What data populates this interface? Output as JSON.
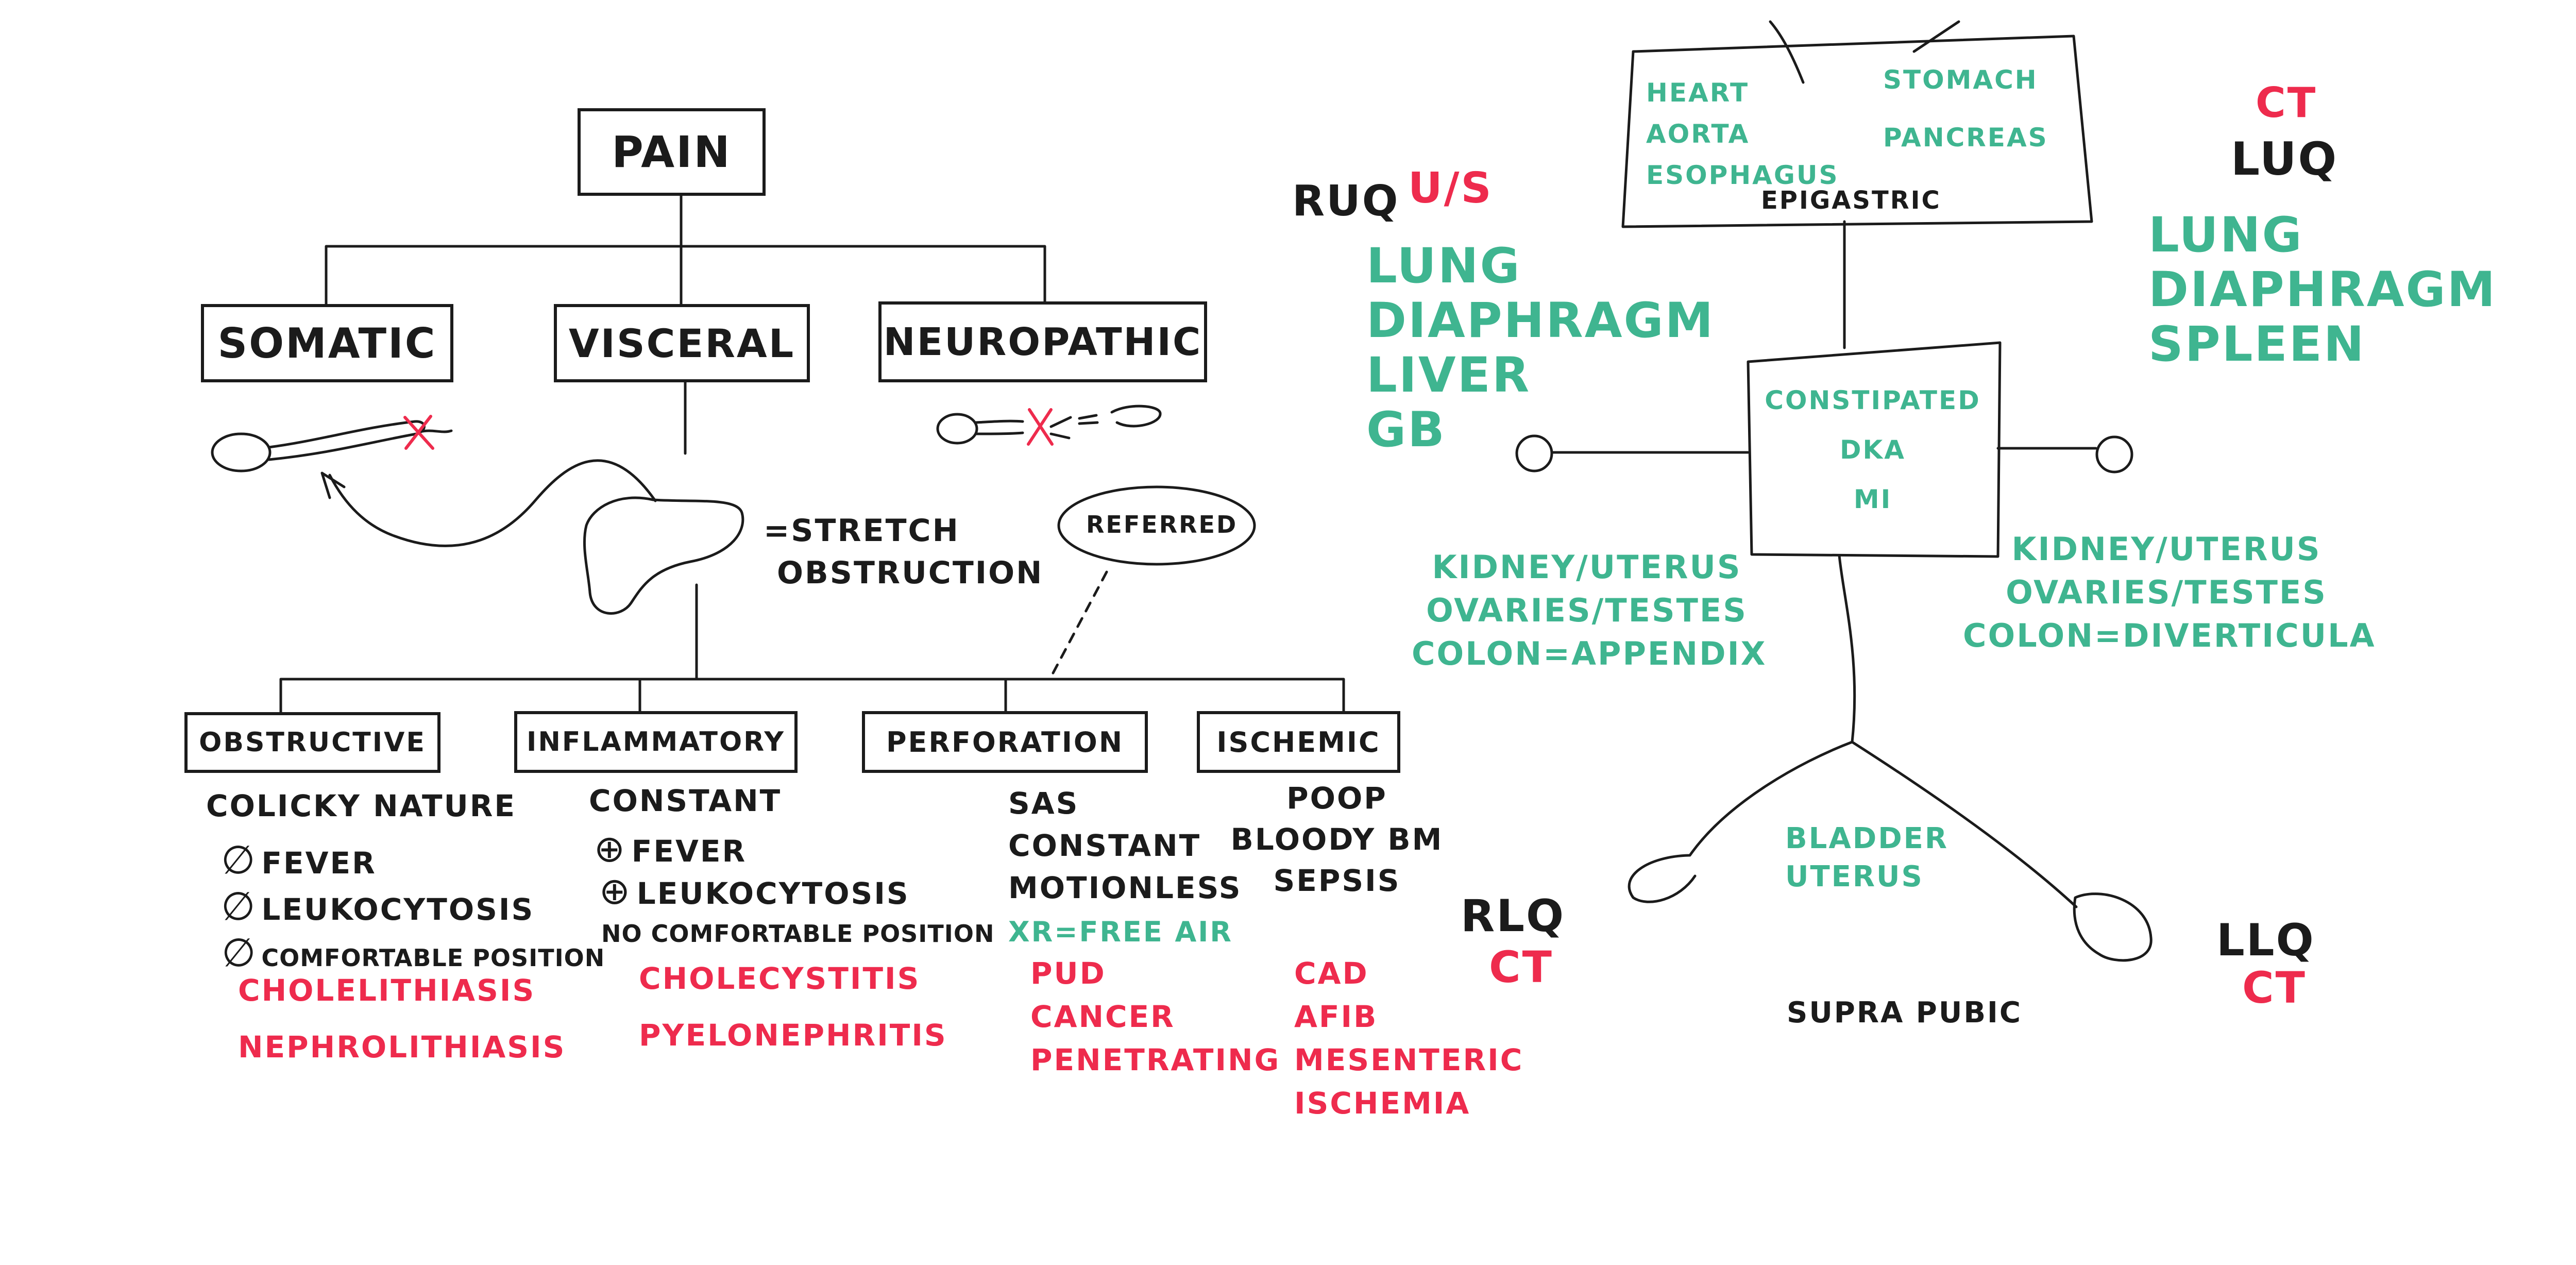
{
  "colors": {
    "ink": "#1b1b1b",
    "green": "#3fb590",
    "red": "#ee2b4d"
  },
  "pain": {
    "root": "PAIN",
    "types": {
      "somatic": "SOMATIC",
      "visceral": "VISCERAL",
      "neuropathic": "NEUROPATHIC"
    },
    "visceral_note": {
      "line1": "=STRETCH",
      "line2": "OBSTRUCTION"
    },
    "referred": "REFERRED",
    "categories": {
      "obstructive": {
        "label": "OBSTRUCTIVE",
        "features": {
          "nature": "COLICKY NATURE",
          "fever": "FEVER",
          "leuko": "LEUKOCYTOSIS",
          "position": "COMFORTABLE POSITION"
        },
        "examples": [
          "CHOLELITHIASIS",
          "NEPHROLITHIASIS"
        ]
      },
      "inflammatory": {
        "label": "INFLAMMATORY",
        "features": {
          "nature": "CONSTANT",
          "fever": "FEVER",
          "leuko": "LEUKOCYTOSIS",
          "position": "NO COMFORTABLE POSITION"
        },
        "examples": [
          "CHOLECYSTITIS",
          "PYELONEPHRITIS"
        ]
      },
      "perforation": {
        "label": "PERFORATION",
        "features": [
          "SAS",
          "CONSTANT",
          "MOTIONLESS"
        ],
        "imaging": "XR=FREE AIR",
        "examples": [
          "PUD",
          "CANCER",
          "PENETRATING"
        ]
      },
      "ischemic": {
        "label": "ISCHEMIC",
        "features": [
          "POOP",
          "BLOODY BM",
          "SEPSIS"
        ],
        "examples": [
          "CAD",
          "AFIB",
          "MESENTERIC",
          "ISCHEMIA"
        ]
      }
    }
  },
  "abdomen": {
    "epigastric": {
      "label": "EPIGASTRIC",
      "organs_left": [
        "HEART",
        "AORTA",
        "ESOPHAGUS"
      ],
      "organs_right": [
        "STOMACH",
        "PANCREAS"
      ]
    },
    "center": [
      "CONSTIPATED",
      "DKA",
      "MI"
    ],
    "ruq": {
      "label": "RUQ",
      "imaging": "U/S",
      "organs": [
        "LUNG",
        "DIAPHRAGM",
        "LIVER",
        "GB"
      ]
    },
    "luq": {
      "label": "LUQ",
      "imaging": "CT",
      "organs": [
        "LUNG",
        "DIAPHRAGM",
        "SPLEEN"
      ]
    },
    "rlq": {
      "label": "RLQ",
      "imaging": "CT",
      "organs": [
        "KIDNEY/UTERUS",
        "OVARIES/TESTES",
        "COLON=APPENDIX"
      ]
    },
    "llq": {
      "label": "LLQ",
      "imaging": "CT",
      "organs": [
        "KIDNEY/UTERUS",
        "OVARIES/TESTES",
        "COLON=DIVERTICULA"
      ]
    },
    "suprapubic": {
      "label": "SUPRA PUBIC",
      "organs": [
        "BLADDER",
        "UTERUS"
      ]
    }
  }
}
